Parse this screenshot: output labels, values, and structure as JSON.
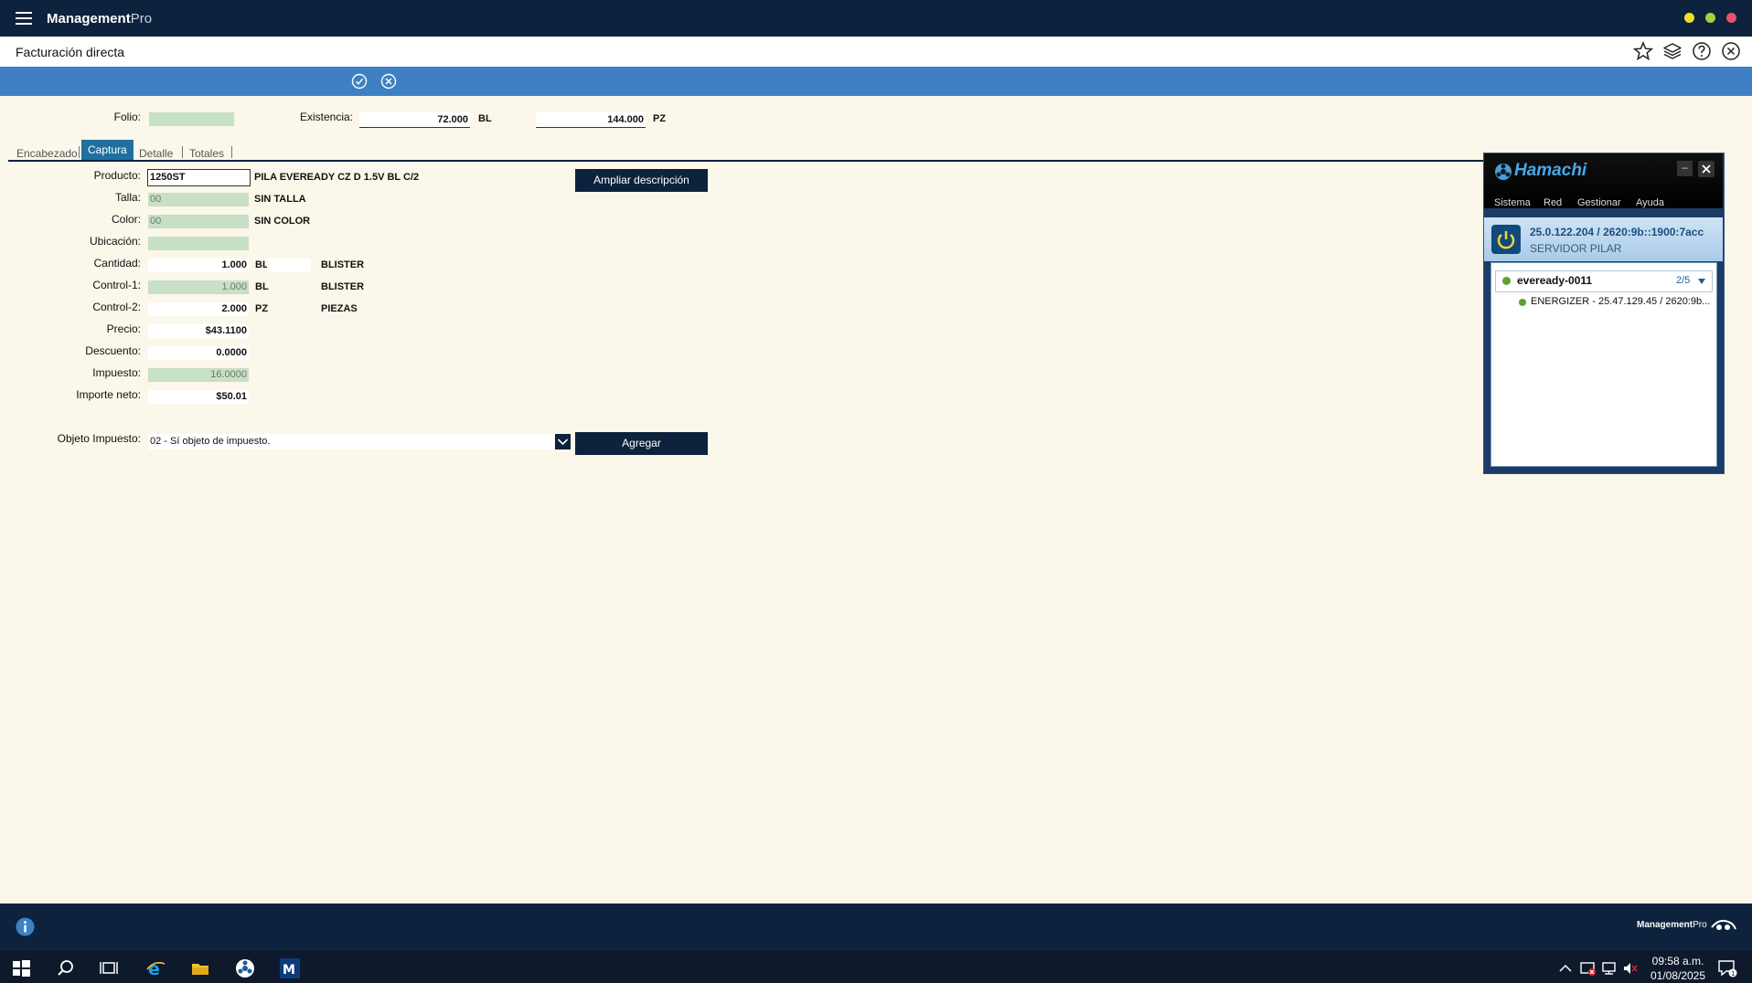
{
  "app": {
    "name": "Management",
    "name_suffix": "Pro"
  },
  "page": {
    "title": "Facturación directa"
  },
  "form": {
    "folio_label": "Folio:",
    "folio_value": "",
    "existencia_label": "Existencia:",
    "existencia_bl_value": "72.000",
    "existencia_bl_unit": "BL",
    "existencia_pz_value": "144.000",
    "existencia_pz_unit": "PZ"
  },
  "tabs": [
    "Encabezado",
    "Captura",
    "Detalle",
    "Totales"
  ],
  "capture": {
    "producto_label": "Producto:",
    "producto_value": "1250ST",
    "producto_desc": "PILA EVEREADY CZ D 1.5V BL C/2",
    "talla_label": "Talla:",
    "talla_value": "00",
    "talla_desc": "SIN TALLA",
    "color_label": "Color:",
    "color_value": "00",
    "color_desc": "SIN COLOR",
    "ubicacion_label": "Ubicación:",
    "ubicacion_value": "",
    "cantidad_label": "Cantidad:",
    "cantidad_value": "1.000",
    "cantidad_unit": "BL",
    "cantidad_desc": "BLISTER",
    "control1_label": "Control-1:",
    "control1_value": "1.000",
    "control1_unit": "BL",
    "control1_desc": "BLISTER",
    "control2_label": "Control-2:",
    "control2_value": "2.000",
    "control2_unit": "PZ",
    "control2_desc": "PIEZAS",
    "precio_label": "Precio:",
    "precio_value": "$43.1100",
    "descuento_label": "Descuento:",
    "descuento_value": "0.0000",
    "impuesto_label": "Impuesto:",
    "impuesto_value": "16.0000",
    "importe_label": "Importe neto:",
    "importe_value": "$50.01",
    "objeto_label": "Objeto Impuesto:",
    "objeto_value": "02 - Sí objeto de impuesto.",
    "ampliar_button": "Ampliar descripción",
    "agregar_button": "Agregar"
  },
  "hamachi": {
    "title": "Hamachi",
    "menu": [
      "Sistema",
      "Red",
      "Gestionar",
      "Ayuda"
    ],
    "address": "25.0.122.204 / 2620:9b::1900:7acc",
    "host": "SERVIDOR PILAR",
    "network": {
      "name": "eveready-0011",
      "count": "2/5"
    },
    "member": "ENERGIZER - 25.47.129.45 / 2620:9b..."
  },
  "footer": {
    "brand": "Management",
    "brand_suffix": "Pro"
  },
  "taskbar": {
    "time": "09:58 a.m.",
    "date": "01/08/2025"
  },
  "colors": {
    "navy": "#0c223d",
    "action_bar": "#3e80c3",
    "active_tab": "#1f6fa0",
    "field_green": "#c8e0c5",
    "background": "#fbf7ea"
  }
}
